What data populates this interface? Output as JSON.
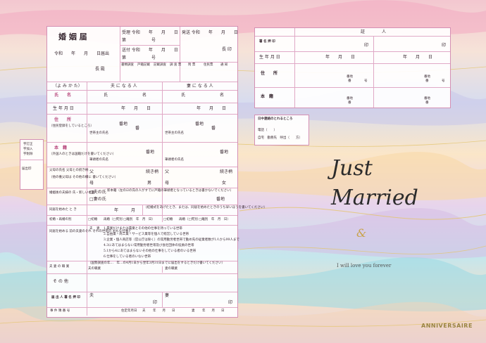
{
  "form": {
    "title": "婚 姻 届",
    "notification_date": "令和　　年　　月　　日届出",
    "recipient_suffix": "長 殿",
    "reception_row1": "受理 令和　　年　　月　　日",
    "reception_row1b": "第　　　　　　号",
    "reception_row2": "送付 令和　　年　　月　　日",
    "reception_row2b": "第　　　　　　号",
    "delivery_label": "発送 令和　　年　　月　　日",
    "delivery_suffix": "長 印",
    "office_cols": [
      "書類調査",
      "戸籍記載",
      "記載調査",
      "調 査 票",
      "附 票",
      "住民票",
      "通 知"
    ],
    "reading_label": "（よ み か た）",
    "husband_header": "夫 に な る 人",
    "wife_header": "妻 に な る 人",
    "name_label": "氏　　名",
    "family_name": "氏",
    "given_name": "名",
    "birthdate_label": "生 年 月 日",
    "ymd": "年　　月　　日",
    "address_label": "住　　所",
    "address_note": "（住民登録をしているところ）",
    "banchi": "番地",
    "ban": "番",
    "go": "号",
    "head_of_household": "世帯主の氏名",
    "honseki_label": "本　籍",
    "honseki_note": "（外国人のときは国籍だけを書いてください）",
    "head_of_registry": "筆頭者の氏名",
    "parents_label": "父母の氏名 父母との続き柄",
    "parents_note": "（他の養父母は その他の欄に 書いてください）",
    "father": "父",
    "mother": "母",
    "relation": "続き柄",
    "son": "男",
    "daughter": "女",
    "new_surname_label": "婚姻後の夫婦の 氏・新しい本籍",
    "husband_surname_opt": "□夫の氏",
    "wife_surname_opt": "□妻の氏",
    "new_honseki_text": "新本籍（左の☑の氏の人がすでに戸籍の筆頭者となっているときは書かないでください）",
    "cohabit_label": "同居を始めた と き",
    "cohabit_note": "（結婚式をあげたとき、または、同居を始めたときのうち早いほうを書いてください）",
    "year_month": "年　　　月",
    "marriage_history_label": "初婚・再婚の別",
    "first_marriage": "□初婚",
    "remarriage": "再婚（□死別 □離別　年　月　日）",
    "occupation_label": "同居を始める 前の夫妻のそれ ぞれの世帯の おもな仕事と",
    "occupation_options": [
      "1.農業だけまたは農業とその他の仕事を持っている世帯",
      "2.自由業・商工業・サービス業等を個人で経営している世帯",
      "3.企業・個人商店等（官公庁は除く）の常用勤労者世帯で勤め先の従業者数が1人から99人まで",
      "4.3にあてはまらない常用勤労者世帯及び会社団体の役員の世帯",
      "5.1から4にあてはまらないその他の仕事をしている者のいる世帯",
      "6.仕事をしている者のいない世帯"
    ],
    "husband_short": "夫",
    "wife_short": "妻",
    "job_label": "夫 妻 の 職 業",
    "census_note": "（国勢調査の年…　年…の4月1日から翌年3月31日までに届出をするときだけ書いてください）",
    "husband_job": "夫の職業",
    "wife_job": "妻の職業",
    "other_label": "そ の 他",
    "signer_label": "届 出 人 署 名 押 印",
    "seal": "印",
    "contact_label": "事 件 簿 番 号",
    "residence_label": "住定年月日",
    "left_side": [
      "字訂正",
      "字加入",
      "字削除"
    ],
    "left_seal": "届出印"
  },
  "witness": {
    "header": "証　　　　人",
    "sign_label": "署 名 押 印",
    "birth_label": "生 年 月 日",
    "address_label": "住　　所",
    "honseki_label": "本　籍",
    "seal": "印",
    "ymd": "年　　月　　日",
    "banchi": "番地",
    "ban": "番",
    "go": "号"
  },
  "contact": {
    "title": "日中連絡のとれるところ",
    "phone": "電話（　　）",
    "phone_type": "自宅　勤務先　呼出（　　方）"
  },
  "decoration": {
    "line1": "Just",
    "line2": "Married",
    "ampersand": "&",
    "tagline": "I will love you forever",
    "brand": "ANNIVERSAIRE"
  }
}
